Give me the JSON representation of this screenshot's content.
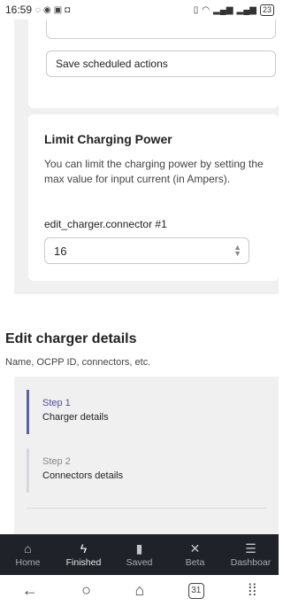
{
  "status_bar": {
    "time": "16:59",
    "battery": "23"
  },
  "scheduled": {
    "save_label": "Save scheduled actions"
  },
  "limit_power": {
    "title": "Limit Charging Power",
    "description": "You can limit the charging power by setting the max value for input current (in Ampers).",
    "field_label": "edit_charger.connector #1",
    "value": "16"
  },
  "edit_details": {
    "title": "Edit charger details",
    "subtitle": "Name, OCPP ID, connectors, etc.",
    "steps": [
      {
        "number": "Step 1",
        "name": "Charger details"
      },
      {
        "number": "Step 2",
        "name": "Connectors details"
      }
    ]
  },
  "bottom_nav": {
    "items": [
      {
        "label": "Home",
        "icon": "home-icon"
      },
      {
        "label": "Finished",
        "icon": "lightning-icon"
      },
      {
        "label": "Saved",
        "icon": "bookmark-icon"
      },
      {
        "label": "Beta",
        "icon": "tools-icon"
      },
      {
        "label": "Dashboar",
        "icon": "menu-icon"
      }
    ]
  },
  "system_nav": {
    "calendar_day": "31"
  }
}
